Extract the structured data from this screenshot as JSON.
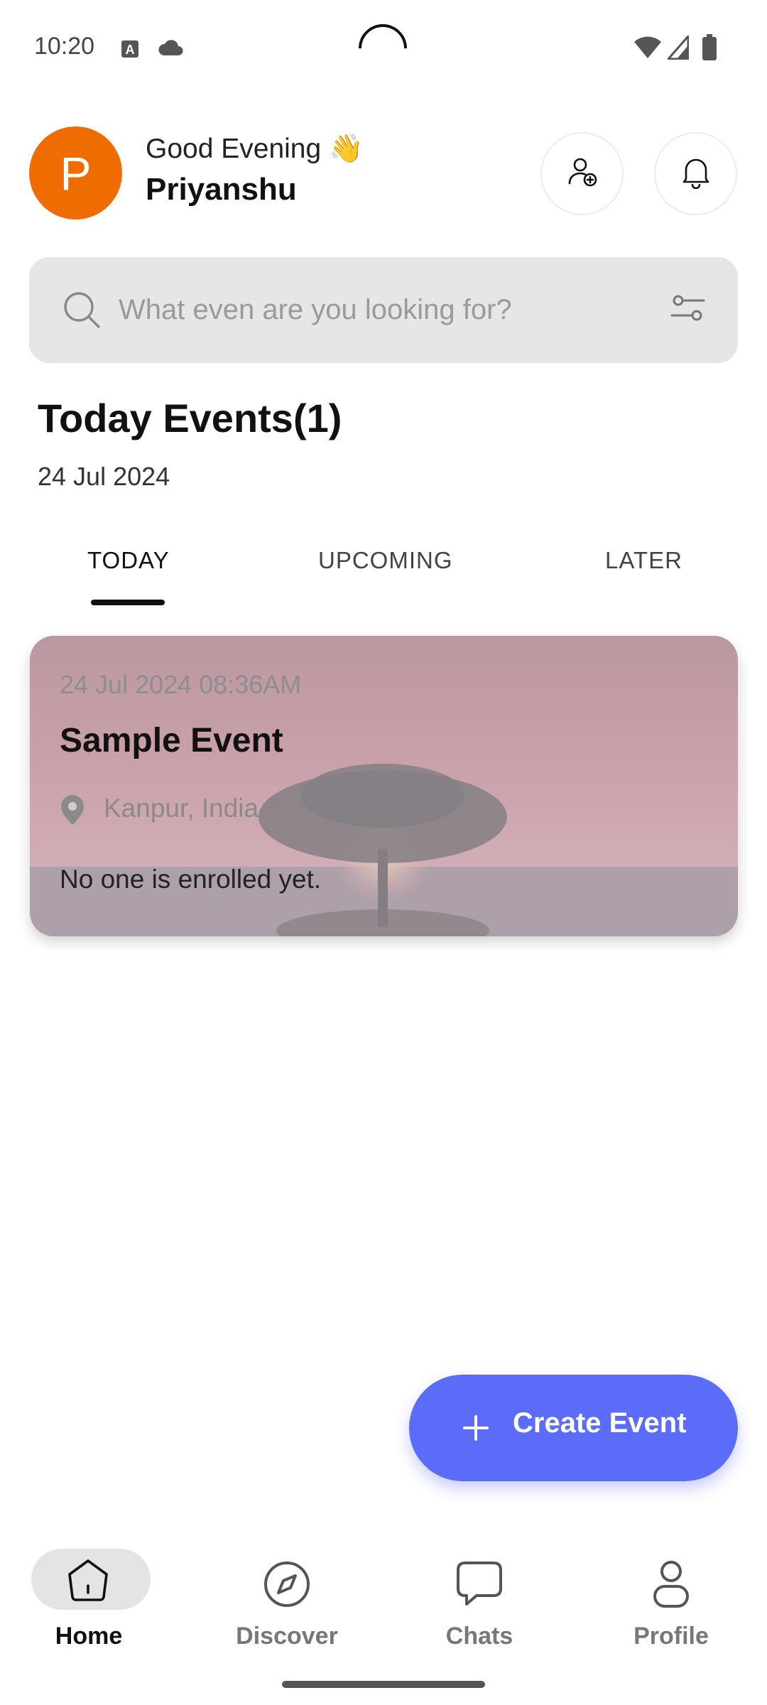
{
  "status_bar": {
    "time": "10:20",
    "icons": [
      "a-box-icon",
      "cloud-icon",
      "wifi-icon",
      "signal-icon",
      "battery-icon"
    ]
  },
  "header": {
    "avatar_letter": "P",
    "greeting": "Good Evening 👋",
    "username": "Priyanshu",
    "actions": [
      "add-user-icon",
      "bell-icon"
    ]
  },
  "search": {
    "placeholder": "What even are you looking for?"
  },
  "section": {
    "title": "Today Events(1)",
    "date": "24 Jul 2024"
  },
  "tabs": [
    {
      "label": "TODAY",
      "active": true
    },
    {
      "label": "UPCOMING",
      "active": false
    },
    {
      "label": "LATER",
      "active": false
    }
  ],
  "event_card": {
    "datetime": "24 Jul 2024 08:36AM",
    "title": "Sample Event",
    "location": "Kanpur, India",
    "enrolled_text": "No one is enrolled yet."
  },
  "fab": {
    "label": "Create Event"
  },
  "bottom_nav": [
    {
      "label": "Home",
      "icon": "home-icon",
      "active": true
    },
    {
      "label": "Discover",
      "icon": "compass-icon",
      "active": false
    },
    {
      "label": "Chats",
      "icon": "chat-icon",
      "active": false
    },
    {
      "label": "Profile",
      "icon": "person-icon",
      "active": false
    }
  ],
  "colors": {
    "accent": "#5b6df8",
    "avatar": "#ef6c00",
    "search_bg": "#e6e6e6"
  }
}
